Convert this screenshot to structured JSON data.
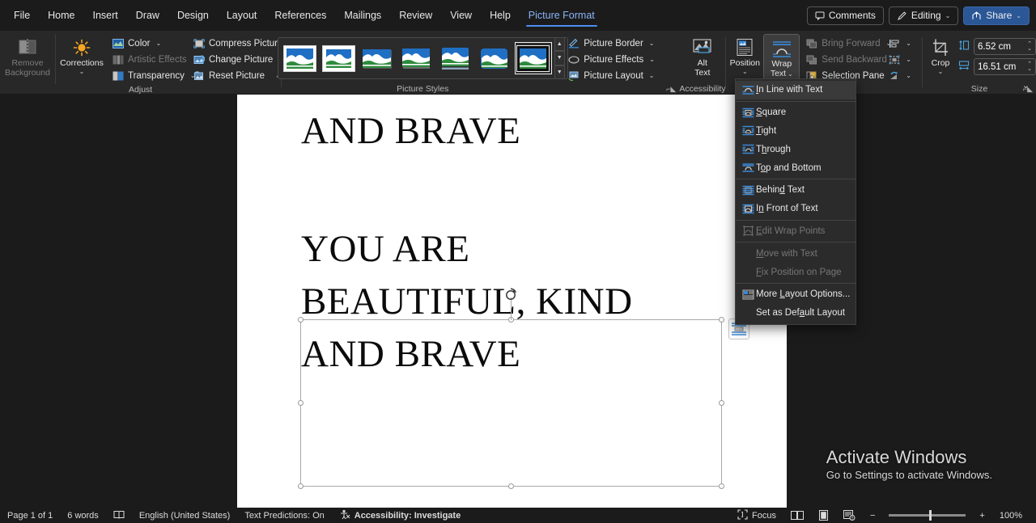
{
  "tabs": [
    {
      "label": "File",
      "active": false
    },
    {
      "label": "Home",
      "active": false
    },
    {
      "label": "Insert",
      "active": false
    },
    {
      "label": "Draw",
      "active": false
    },
    {
      "label": "Design",
      "active": false
    },
    {
      "label": "Layout",
      "active": false
    },
    {
      "label": "References",
      "active": false
    },
    {
      "label": "Mailings",
      "active": false
    },
    {
      "label": "Review",
      "active": false
    },
    {
      "label": "View",
      "active": false
    },
    {
      "label": "Help",
      "active": false
    },
    {
      "label": "Picture Format",
      "active": true
    }
  ],
  "titlebar": {
    "comments_label": "Comments",
    "editing_label": "Editing",
    "share_label": "Share"
  },
  "ribbon": {
    "groups": {
      "adjust": {
        "label": "Adjust",
        "remove_background": "Remove\nBackground",
        "remove_background_l1": "Remove",
        "remove_background_l2": "Background",
        "corrections": "Corrections",
        "color": "Color",
        "artistic_effects": "Artistic Effects",
        "transparency": "Transparency",
        "compress_pictures": "Compress Pictures",
        "change_picture": "Change Picture",
        "reset_picture": "Reset Picture"
      },
      "picture_styles": {
        "label": "Picture Styles",
        "selected_index": 6,
        "count": 7
      },
      "borders": {
        "picture_border": "Picture Border",
        "picture_effects": "Picture Effects",
        "picture_layout": "Picture Layout"
      },
      "accessibility": {
        "label": "Accessibility",
        "alt_text_l1": "Alt",
        "alt_text_l2": "Text"
      },
      "arrange": {
        "position_label": "Position",
        "wrap_text_l1": "Wrap",
        "wrap_text_l2": "Text",
        "bring_forward": "Bring Forward",
        "send_backward": "Send Backward",
        "selection_pane": "Selection Pane"
      },
      "size": {
        "label": "Size",
        "crop_label": "Crop",
        "height_value": "6.52 cm",
        "width_value": "16.51 cm"
      }
    }
  },
  "wrap_menu": {
    "items": [
      {
        "label": "In Line with Text",
        "accel": "I",
        "icon": "wrap-inline-icon",
        "disabled": false,
        "hover": true,
        "sep_after": true
      },
      {
        "label": "Square",
        "accel": "S",
        "icon": "wrap-square-icon",
        "disabled": false,
        "hover": false,
        "sep_after": false
      },
      {
        "label": "Tight",
        "accel": "T",
        "icon": "wrap-tight-icon",
        "disabled": false,
        "hover": false,
        "sep_after": false
      },
      {
        "label": "Through",
        "accel": "h",
        "icon": "wrap-through-icon",
        "disabled": false,
        "hover": false,
        "sep_after": false
      },
      {
        "label": "Top and Bottom",
        "accel": "o",
        "icon": "wrap-topbottom-icon",
        "disabled": false,
        "hover": false,
        "sep_after": true
      },
      {
        "label": "Behind Text",
        "accel": "d",
        "icon": "wrap-behind-icon",
        "disabled": false,
        "hover": false,
        "sep_after": false
      },
      {
        "label": "In Front of Text",
        "accel": "n",
        "icon": "wrap-infront-icon",
        "disabled": false,
        "hover": false,
        "sep_after": true
      },
      {
        "label": "Edit Wrap Points",
        "accel": "E",
        "icon": "edit-wrap-points-icon",
        "disabled": true,
        "hover": false,
        "sep_after": true
      },
      {
        "label": "Move with Text",
        "accel": "M",
        "icon": "none",
        "disabled": true,
        "hover": false,
        "sep_after": false
      },
      {
        "label": "Fix Position on Page",
        "accel": "F",
        "icon": "none",
        "disabled": true,
        "hover": false,
        "sep_after": true
      },
      {
        "label": "More Layout Options...",
        "accel": "L",
        "icon": "more-layout-options-icon",
        "disabled": false,
        "hover": false,
        "sep_after": false
      },
      {
        "label": "Set as Default Layout",
        "accel": "a",
        "icon": "none",
        "disabled": false,
        "hover": false,
        "sep_after": false
      }
    ]
  },
  "document": {
    "top_partial_line": "AND BRAVE",
    "selected_image_lines": [
      "YOU ARE",
      "BEAUTIFUL, KIND",
      "AND BRAVE"
    ]
  },
  "status": {
    "page": "Page 1 of 1",
    "words": "6 words",
    "language": "English (United States)",
    "predictions": "Text Predictions: On",
    "accessibility": "Accessibility: Investigate",
    "focus": "Focus",
    "zoom": "100%"
  },
  "watermark": {
    "line1": "Activate Windows",
    "line2": "Go to Settings to activate Windows."
  },
  "colors": {
    "accent_blue": "#4a8df0",
    "share_blue": "#2b5797",
    "ribbon_bg": "#282828",
    "menu_bg": "#2b2b2b",
    "icon_blue": "#3b8ad8"
  }
}
